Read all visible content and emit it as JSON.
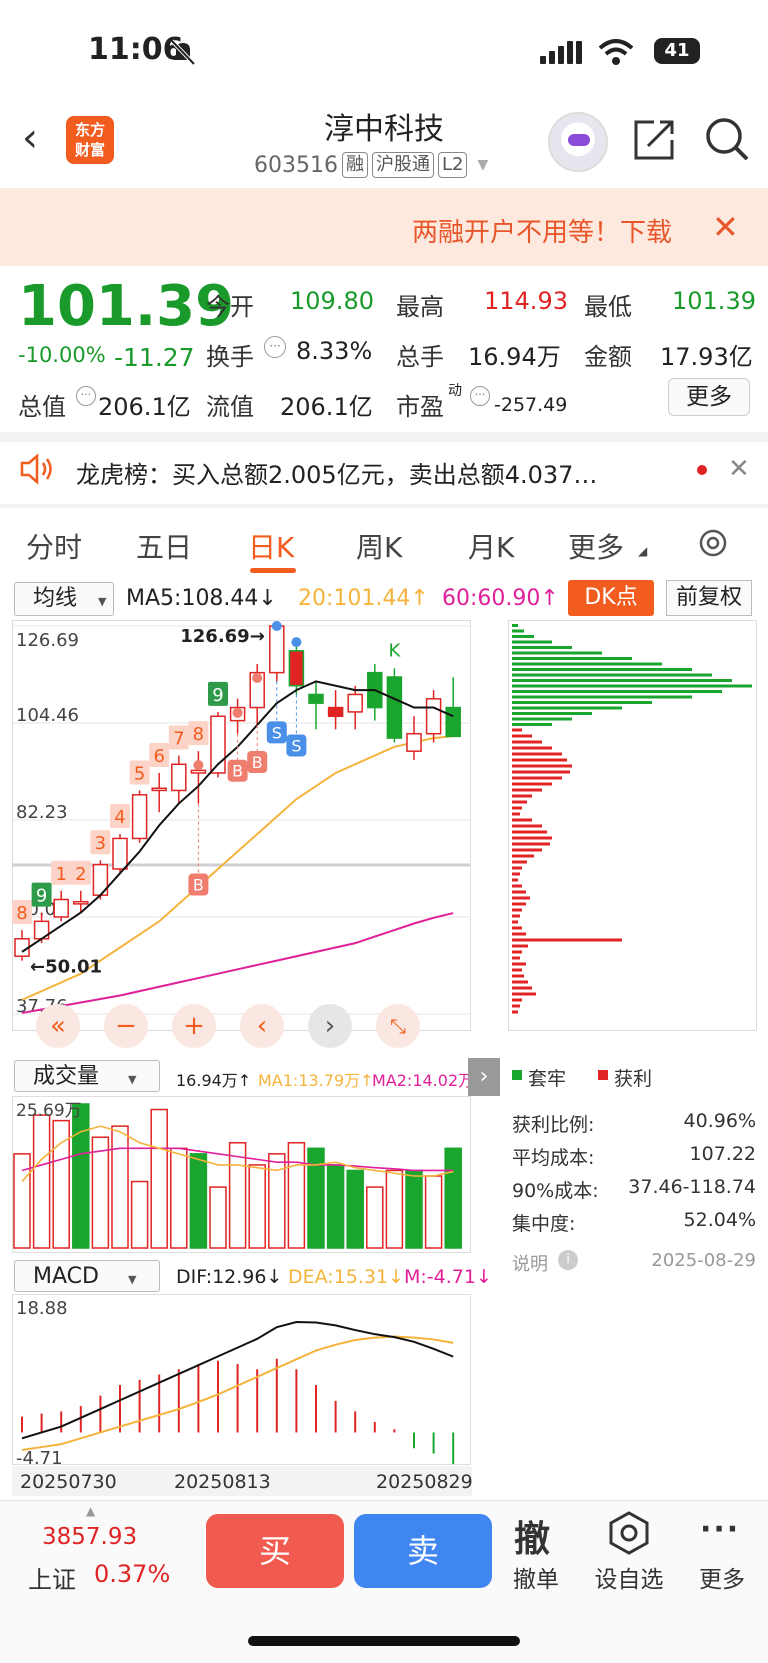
{
  "status_bar": {
    "time": "11:06",
    "battery": "41",
    "icons": [
      "bell-slash-icon",
      "signal-icon",
      "wifi-icon",
      "battery-icon"
    ]
  },
  "header": {
    "logo_text_1": "东方",
    "logo_text_2": "财富",
    "stock_name": "淳中科技",
    "stock_code": "603516",
    "tags": [
      "融",
      "沪股通",
      "L2"
    ]
  },
  "banner": {
    "text": "两融开户不用等！下载",
    "close": "✕"
  },
  "quote": {
    "price": "101.39",
    "change_pct": "-10.00%",
    "change": "-11.27",
    "rows": [
      [
        {
          "label": "今开",
          "value": "109.80",
          "color": "green"
        },
        {
          "label": "最高",
          "value": "114.93",
          "color": "red"
        },
        {
          "label": "最低",
          "value": "101.39",
          "color": "green"
        }
      ],
      [
        {
          "label": "换手",
          "value": "8.33%",
          "color": "black"
        },
        {
          "label": "总手",
          "value": "16.94万",
          "color": "black"
        },
        {
          "label": "金额",
          "value": "17.93亿",
          "color": "black"
        }
      ]
    ],
    "total_cap_label": "总值",
    "total_cap": "206.1亿",
    "float_cap_label": "流值",
    "float_cap": "206.1亿",
    "pe_label": "市盈",
    "pe_sup": "动",
    "pe": "-257.49",
    "more": "更多"
  },
  "news": {
    "text": "龙虎榜：买入总额2.005亿元，卖出总额4.037…",
    "close": "✕"
  },
  "tabs": [
    "分时",
    "五日",
    "日K",
    "周K",
    "月K",
    "更多"
  ],
  "active_tab": "日K",
  "chart_toolbar": {
    "indicator": "均线",
    "ma5": "MA5:108.44↓",
    "ma20": "20:101.44↑",
    "ma60": "60:60.90↑",
    "dk": "DK点",
    "adjust": "前复权"
  },
  "chart_data": {
    "type": "candlestick",
    "ylim": [
      37.76,
      126.69
    ],
    "y_ticks": [
      "126.69",
      "104.46",
      "82.23",
      "60.00",
      "37.76"
    ],
    "x_ticks": [
      "20250730",
      "20250813",
      "20250829"
    ],
    "max_label": "126.69→",
    "min_label": "←50.01",
    "candles": [
      {
        "o": 51,
        "c": 55,
        "h": 57,
        "l": 50
      },
      {
        "o": 55,
        "c": 59,
        "h": 61,
        "l": 54
      },
      {
        "o": 60,
        "c": 64,
        "h": 66,
        "l": 59
      },
      {
        "o": 63,
        "c": 63.5,
        "h": 66,
        "l": 61
      },
      {
        "o": 65,
        "c": 72,
        "h": 73,
        "l": 64
      },
      {
        "o": 71,
        "c": 78,
        "h": 79,
        "l": 70
      },
      {
        "o": 78,
        "c": 88,
        "h": 89,
        "l": 77
      },
      {
        "o": 89,
        "c": 89.5,
        "h": 93,
        "l": 84
      },
      {
        "o": 89,
        "c": 95,
        "h": 97,
        "l": 86
      },
      {
        "o": 93,
        "c": 93.6,
        "h": 98,
        "l": 86
      },
      {
        "o": 93,
        "c": 106,
        "h": 107,
        "l": 92
      },
      {
        "o": 105,
        "c": 108,
        "h": 110,
        "l": 102
      },
      {
        "o": 108,
        "c": 116,
        "h": 118,
        "l": 104
      },
      {
        "o": 116,
        "c": 126.69,
        "h": 126.69,
        "l": 114
      },
      {
        "o": 121,
        "c": 113,
        "h": 123,
        "l": 111
      },
      {
        "o": 111,
        "c": 109,
        "h": 114,
        "l": 103
      },
      {
        "o": 106,
        "c": 108,
        "h": 112,
        "l": 103
      },
      {
        "o": 107,
        "c": 111,
        "h": 113,
        "l": 103
      },
      {
        "o": 116,
        "c": 108,
        "h": 118,
        "l": 105
      },
      {
        "o": 115,
        "c": 101,
        "h": 117,
        "l": 100
      },
      {
        "o": 98,
        "c": 102,
        "h": 106,
        "l": 96
      },
      {
        "o": 102,
        "c": 110,
        "h": 112,
        "l": 100
      },
      {
        "o": 108,
        "c": 101.39,
        "h": 114.93,
        "l": 101.39
      }
    ],
    "ma5": [
      52,
      55,
      58,
      61,
      65,
      70,
      75,
      81,
      86,
      90,
      95,
      99,
      104,
      109,
      112,
      114,
      113,
      112,
      112,
      110,
      108,
      108,
      106
    ],
    "ma20": [
      41,
      43,
      45,
      47,
      50,
      53,
      56,
      59,
      63,
      67,
      71,
      75,
      79,
      83,
      87,
      90,
      93,
      95,
      97,
      99,
      100,
      101,
      101.44
    ],
    "ma60": [
      38,
      38.8,
      39.6,
      40.4,
      41.2,
      42,
      43,
      44,
      45,
      46,
      47,
      48,
      49,
      50,
      51,
      52,
      53,
      54,
      55.5,
      57,
      58.5,
      59.8,
      60.9
    ],
    "signals": [
      {
        "i": 0,
        "text": "8",
        "kind": "td"
      },
      {
        "i": 1,
        "text": "9",
        "kind": "td9"
      },
      {
        "i": 2,
        "text": "1",
        "kind": "td"
      },
      {
        "i": 3,
        "text": "2",
        "kind": "td"
      },
      {
        "i": 4,
        "text": "3",
        "kind": "td"
      },
      {
        "i": 5,
        "text": "4",
        "kind": "td"
      },
      {
        "i": 6,
        "text": "5",
        "kind": "td"
      },
      {
        "i": 7,
        "text": "6",
        "kind": "td"
      },
      {
        "i": 8,
        "text": "7",
        "kind": "td"
      },
      {
        "i": 9,
        "text": "8",
        "kind": "td"
      },
      {
        "i": 10,
        "text": "9",
        "kind": "td9"
      }
    ],
    "bs_marks": [
      {
        "i": 9,
        "text": "B"
      },
      {
        "i": 11,
        "text": "B"
      },
      {
        "i": 12,
        "text": "B"
      },
      {
        "i": 13,
        "text": "S"
      },
      {
        "i": 14,
        "text": "S"
      }
    ],
    "k_mark": {
      "i": 19,
      "text": "K"
    },
    "extra_labels": [
      "60.00",
      "8"
    ]
  },
  "chip_dist": {
    "legend_trap": "套牢",
    "legend_profit": "获利",
    "rows": [
      {
        "label": "获利比例:",
        "value": "40.96%"
      },
      {
        "label": "平均成本:",
        "value": "107.22"
      },
      {
        "label": "90%成本:",
        "value": "37.46-118.74"
      },
      {
        "label": "集中度:",
        "value": "52.04%"
      }
    ],
    "note": "说明",
    "date": "2025-08-29"
  },
  "volume": {
    "indicator": "成交量",
    "vol": "16.94万↑",
    "ma1": "MA1:13.79万↑",
    "ma2": "MA2:14.02万↑",
    "max_label": "25.69万",
    "bars": [
      17,
      24,
      23,
      26,
      20,
      22,
      12,
      25,
      18,
      17,
      11,
      19,
      15,
      17,
      19,
      18,
      15,
      14,
      11,
      14,
      14,
      13,
      18
    ],
    "colors": [
      "r",
      "r",
      "r",
      "g",
      "r",
      "r",
      "r",
      "r",
      "r",
      "g",
      "r",
      "r",
      "r",
      "r",
      "r",
      "g",
      "g",
      "g",
      "r",
      "r",
      "g",
      "r",
      "g"
    ]
  },
  "macd": {
    "indicator": "MACD",
    "dif": "DIF:12.96↓",
    "dea": "DEA:15.31↓",
    "m": "M:-4.71↓",
    "top_label": "18.88",
    "bottom_label": "-4.71",
    "dif_line": [
      -1,
      0,
      1,
      2.5,
      4,
      5.5,
      7,
      8.5,
      10,
      11.5,
      13,
      14.5,
      16,
      18,
      18.88,
      18.8,
      18.3,
      17.5,
      16.8,
      16.3,
      15.5,
      14.3,
      12.96
    ],
    "dea_line": [
      -3,
      -2.5,
      -2,
      -1,
      0,
      1,
      2,
      3,
      4,
      5.2,
      6.5,
      8,
      9.5,
      11,
      12.5,
      14,
      15,
      15.8,
      16.2,
      16.4,
      16.2,
      15.9,
      15.31
    ],
    "hist": [
      1.5,
      1.8,
      2,
      2.5,
      3.5,
      4.5,
      5,
      5.5,
      6,
      6.5,
      6.8,
      6.5,
      6,
      7,
      6,
      4.5,
      3,
      2,
      1,
      0.3,
      -1.5,
      -2,
      -3
    ]
  },
  "bottom": {
    "index_value": "3857.93",
    "index_name": "上证",
    "index_pct": "0.37%",
    "buy": "买",
    "sell": "卖",
    "items": [
      {
        "icon": "撤",
        "label": "撤单"
      },
      {
        "label": "设自选"
      },
      {
        "label": "更多"
      }
    ]
  }
}
